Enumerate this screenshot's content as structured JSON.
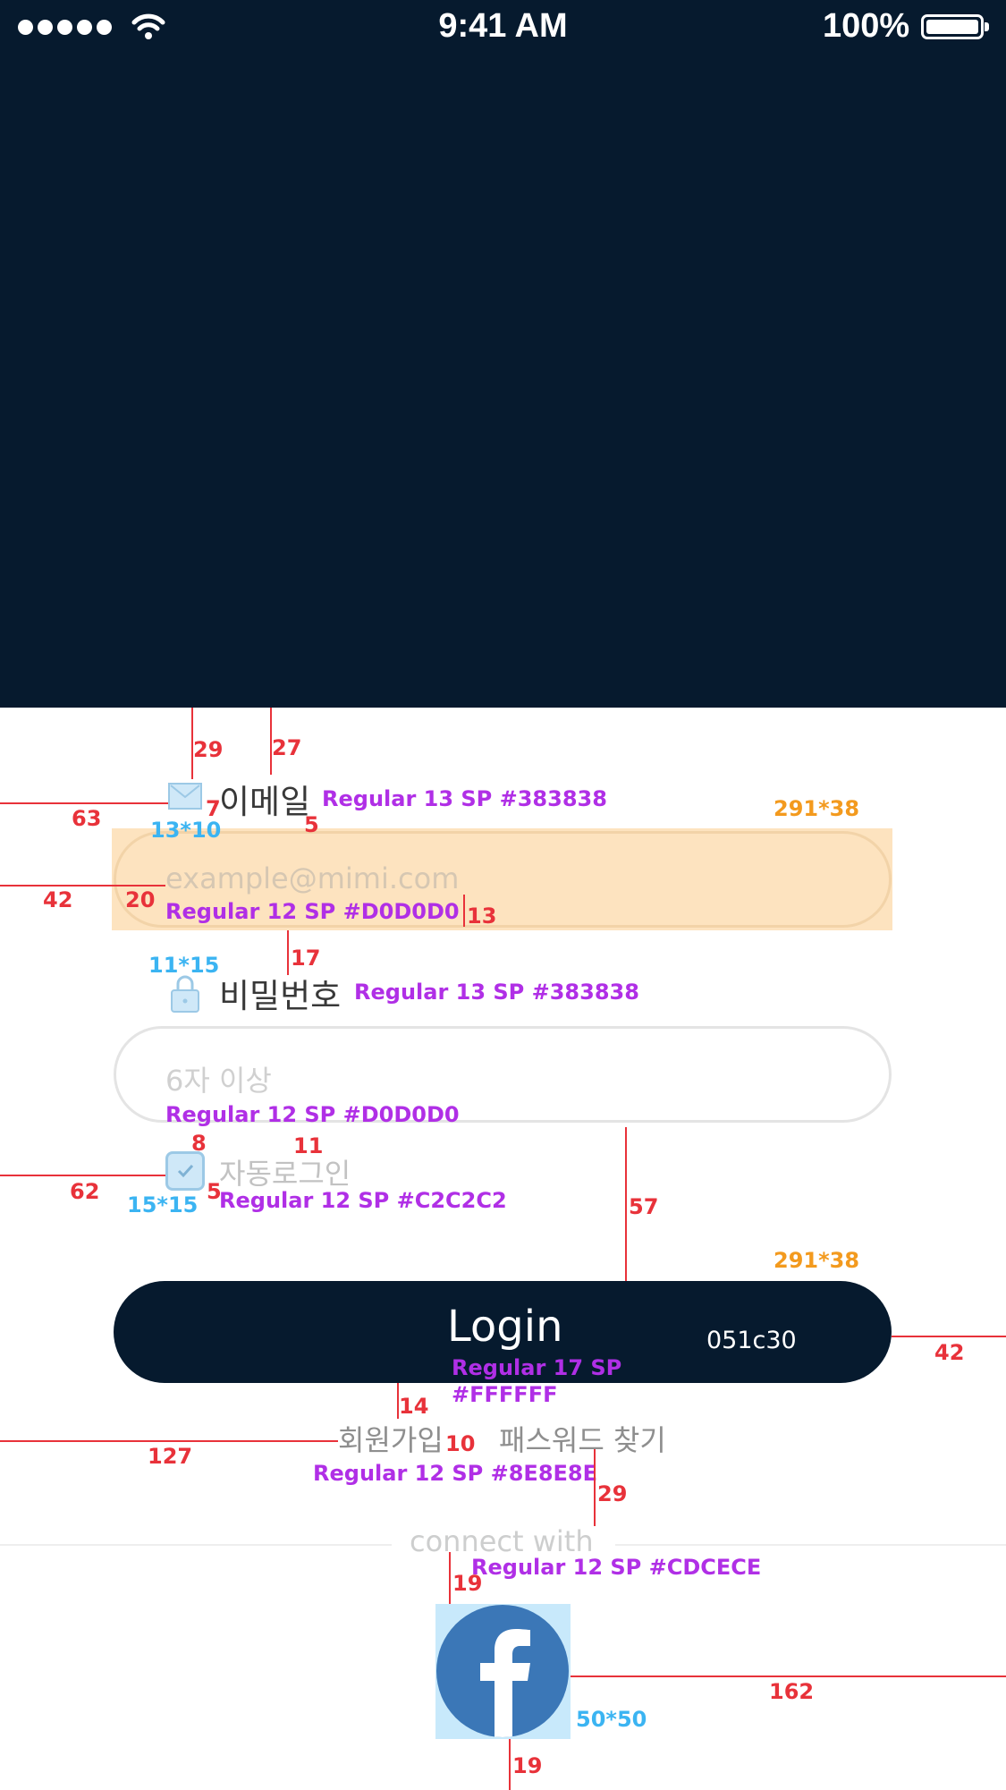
{
  "status_bar": {
    "time": "9:41 AM",
    "battery": "100%"
  },
  "email": {
    "label": "이메일",
    "placeholder": "example@mimi.com"
  },
  "password": {
    "label": "비밀번호",
    "placeholder": "6자 이상"
  },
  "auto_login": {
    "label": "자동로그인",
    "checked": true
  },
  "login_button": {
    "label": "Login",
    "color_code": "051c30"
  },
  "links": {
    "signup": "회원가입",
    "find_password": "패스워드 찾기"
  },
  "connect": {
    "label": "connect with"
  },
  "colors": {
    "hero": "#061a2e",
    "button": "#051c30",
    "facebook": "#3b77b7",
    "label_text": "#383838",
    "placeholder": "#D0D0D0",
    "link_text": "#8E8E8E",
    "connect_text": "#CDCECE",
    "auto_login_text": "#C2C2C2"
  },
  "icons": {
    "email": "mail-icon",
    "password": "lock-icon",
    "checkbox": "checkbox-icon",
    "facebook": "facebook-icon"
  },
  "annotations": {
    "spec_email_label": "Regular 13 SP #383838",
    "spec_email_input": "Regular 12 SP #D0D0D0",
    "spec_password_label": "Regular 13 SP #383838",
    "spec_password_input": "Regular 12 SP #D0D0D0",
    "spec_auto_login": "Regular 12 SP #C2C2C2",
    "spec_login_1": "Regular 17 SP",
    "spec_login_2": "#FFFFFF",
    "spec_links": "Regular 12 SP #8E8E8E",
    "spec_connect": "Regular 12 SP #CDCECE",
    "size_email_icon": "13*10",
    "size_lock_icon": "11*15",
    "size_checkbox": "15*15",
    "size_fb": "50*50",
    "size_email_field": "291*38",
    "size_login_button": "291*38",
    "m_29": "29",
    "m_27": "27",
    "m_63": "63",
    "m_7": "7",
    "m_5a": "5",
    "m_42a": "42",
    "m_20": "20",
    "m_13": "13",
    "m_17": "17",
    "m_8": "8",
    "m_11": "11",
    "m_62": "62",
    "m_5b": "5",
    "m_57": "57",
    "m_42b": "42",
    "m_14": "14",
    "m_10": "10",
    "m_127": "127",
    "m_29b": "29",
    "m_19a": "19",
    "m_162": "162",
    "m_19b": "19"
  }
}
